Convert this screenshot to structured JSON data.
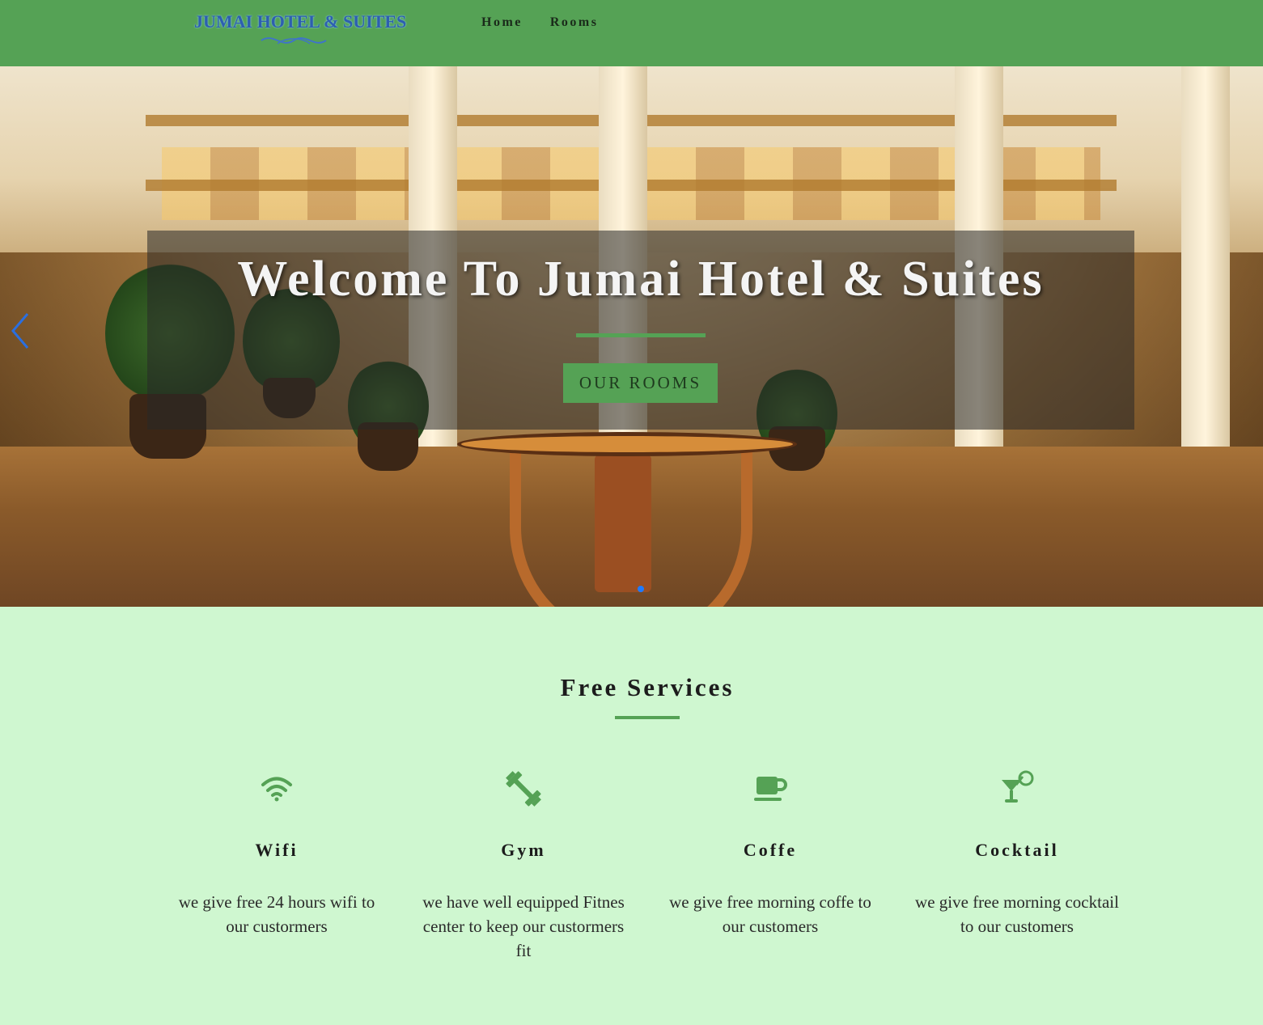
{
  "header": {
    "logo_text": "JUMAI HOTEL & SUITES",
    "nav": [
      {
        "label": "Home"
      },
      {
        "label": "Rooms"
      }
    ]
  },
  "hero": {
    "title": "Welcome To Jumai Hotel & Suites",
    "button_label": "OUR ROOMS",
    "prev_icon": "chevron-left-icon",
    "active_slide_dot_color": "#1f7bff"
  },
  "services": {
    "title": "Free Services",
    "items": [
      {
        "icon": "wifi-icon",
        "name": "Wifi",
        "desc": "we give free 24 hours wifi to our custormers"
      },
      {
        "icon": "dumbbell-icon",
        "name": "Gym",
        "desc": "we have well equipped Fitnes center to keep our custormers fit"
      },
      {
        "icon": "coffee-icon",
        "name": "Coffe",
        "desc": "we give free morning coffe to our customers"
      },
      {
        "icon": "cocktail-icon",
        "name": "Cocktail",
        "desc": "we give free morning cocktail to our customers"
      }
    ]
  },
  "colors": {
    "brand_green": "#55a255",
    "page_bg": "#cff7d0",
    "accent_blue": "#1f7bff"
  }
}
